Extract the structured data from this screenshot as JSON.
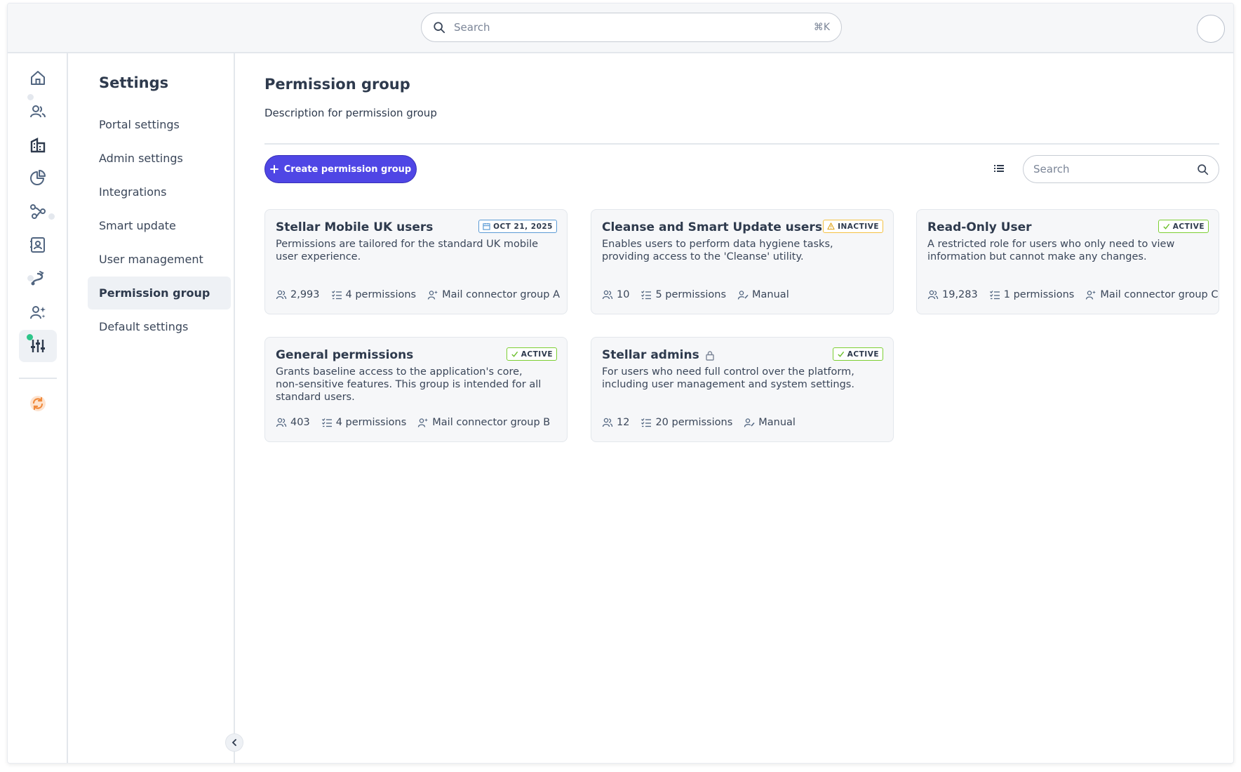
{
  "topbar": {
    "search_placeholder": "Search",
    "search_shortcut": "⌘K"
  },
  "rail": {
    "items": [
      "home",
      "contacts",
      "companies",
      "reports",
      "workflows",
      "directory",
      "integrations",
      "ai-users",
      "settings",
      "sync"
    ],
    "active": "settings"
  },
  "settings_nav": {
    "title": "Settings",
    "items": [
      {
        "label": "Portal settings"
      },
      {
        "label": "Admin settings"
      },
      {
        "label": "Integrations"
      },
      {
        "label": "Smart update"
      },
      {
        "label": "User management"
      },
      {
        "label": "Permission group"
      },
      {
        "label": "Default settings"
      }
    ],
    "active": "Permission group"
  },
  "main": {
    "title": "Permission group",
    "description": "Description for permission group",
    "create_button": "Create permission group",
    "search_placeholder": "Search"
  },
  "colors": {
    "primary": "#4f46e5",
    "active_badge": "#7ccf33",
    "inactive_badge": "#f5c243",
    "date_badge": "#5b9bd5"
  },
  "cards": [
    {
      "title": "Stellar Mobile UK users",
      "badge": "OCT 21, 2025",
      "badge_type": "date",
      "description": "Permissions are tailored for the standard UK mobile user experience.",
      "users": "2,993",
      "permissions": "4 permissions",
      "connector": "Mail connector group A"
    },
    {
      "title": "Cleanse and Smart Update users",
      "badge": "INACTIVE",
      "badge_type": "inactive",
      "description": "Enables users to perform data hygiene tasks, providing access to the 'Cleanse' utility.",
      "users": "10",
      "permissions": "5 permissions",
      "connector": "Manual"
    },
    {
      "title": "Read-Only User",
      "badge": "ACTIVE",
      "badge_type": "active",
      "description": "A restricted role for users who only need to view information but cannot make any changes.",
      "users": "19,283",
      "permissions": "1 permissions",
      "connector": "Mail connector group C"
    },
    {
      "title": "General permissions",
      "badge": "ACTIVE",
      "badge_type": "active",
      "description": "Grants baseline access to the application's core, non-sensitive features. This group is intended for all standard users.",
      "users": "403",
      "permissions": "4 permissions",
      "connector": "Mail connector group B"
    },
    {
      "title": "Stellar admins",
      "locked": true,
      "badge": "ACTIVE",
      "badge_type": "active",
      "description": "For users who need full control over the platform, including user management and system settings.",
      "users": "12",
      "permissions": "20 permissions",
      "connector": "Manual"
    }
  ]
}
